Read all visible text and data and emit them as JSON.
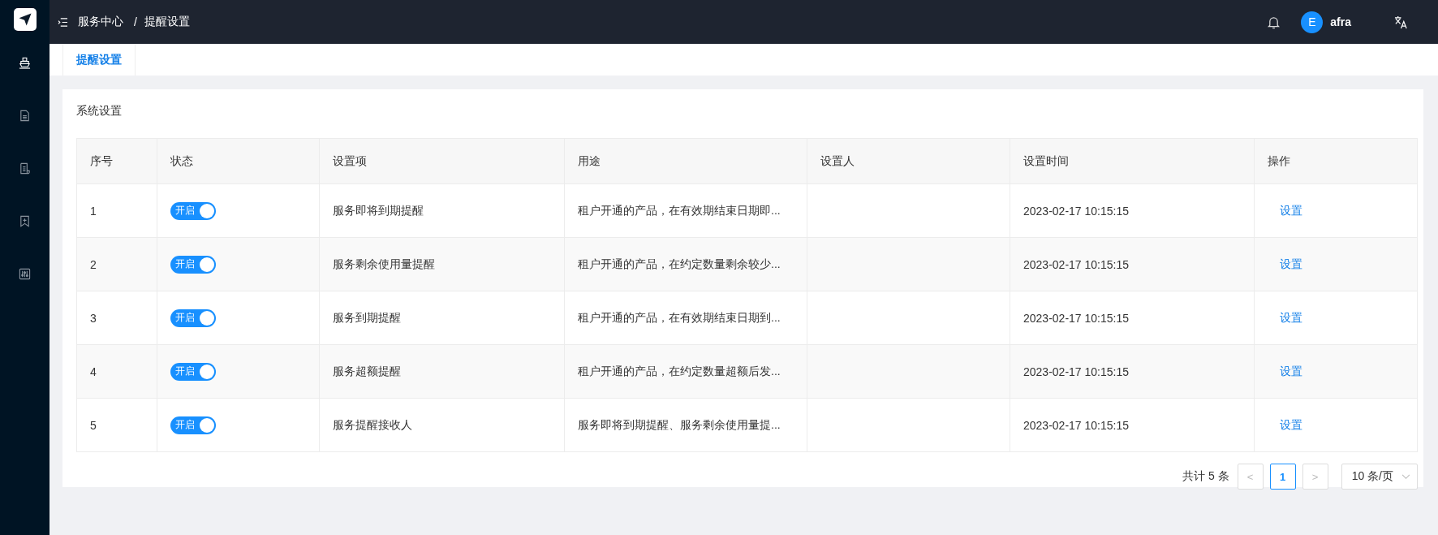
{
  "sidebar": {
    "items": [
      {
        "kind": "ship",
        "selected": true
      },
      {
        "kind": "document",
        "selected": false
      },
      {
        "kind": "scroll",
        "selected": false
      },
      {
        "kind": "bookmark",
        "selected": false
      },
      {
        "kind": "sliders",
        "selected": false
      }
    ]
  },
  "header": {
    "breadcrumb": [
      "服务中心",
      "提醒设置"
    ],
    "separator": "/",
    "user": {
      "initial": "E",
      "name": "afra"
    }
  },
  "tabs": [
    {
      "label": "提醒设置",
      "selected": true
    }
  ],
  "card": {
    "title": "系统设置"
  },
  "table": {
    "columns": [
      "序号",
      "状态",
      "设置项",
      "用途",
      "设置人",
      "设置时间",
      "操作"
    ],
    "rows": [
      {
        "index": "1",
        "status": {
          "on": true,
          "label": "开启"
        },
        "item": "服务即将到期提醒",
        "purpose": "租户开通的产品，在有效期结束日期即...",
        "setter": "",
        "time": "2023-02-17 10:15:15",
        "action": "设置"
      },
      {
        "index": "2",
        "status": {
          "on": true,
          "label": "开启"
        },
        "item": "服务剩余使用量提醒",
        "purpose": "租户开通的产品，在约定数量剩余较少...",
        "setter": "",
        "time": "2023-02-17 10:15:15",
        "action": "设置"
      },
      {
        "index": "3",
        "status": {
          "on": true,
          "label": "开启"
        },
        "item": "服务到期提醒",
        "purpose": "租户开通的产品，在有效期结束日期到...",
        "setter": "",
        "time": "2023-02-17 10:15:15",
        "action": "设置"
      },
      {
        "index": "4",
        "status": {
          "on": true,
          "label": "开启"
        },
        "item": "服务超额提醒",
        "purpose": "租户开通的产品，在约定数量超额后发...",
        "setter": "",
        "time": "2023-02-17 10:15:15",
        "action": "设置"
      },
      {
        "index": "5",
        "status": {
          "on": true,
          "label": "开启"
        },
        "item": "服务提醒接收人",
        "purpose": "服务即将到期提醒、服务剩余使用量提...",
        "setter": "",
        "time": "2023-02-17 10:15:15",
        "action": "设置"
      }
    ]
  },
  "pagination": {
    "total": "共计 5 条",
    "prev": "<",
    "pages": [
      {
        "label": "1",
        "selected": true
      }
    ],
    "next": ">",
    "page_size": "10 条/页"
  }
}
